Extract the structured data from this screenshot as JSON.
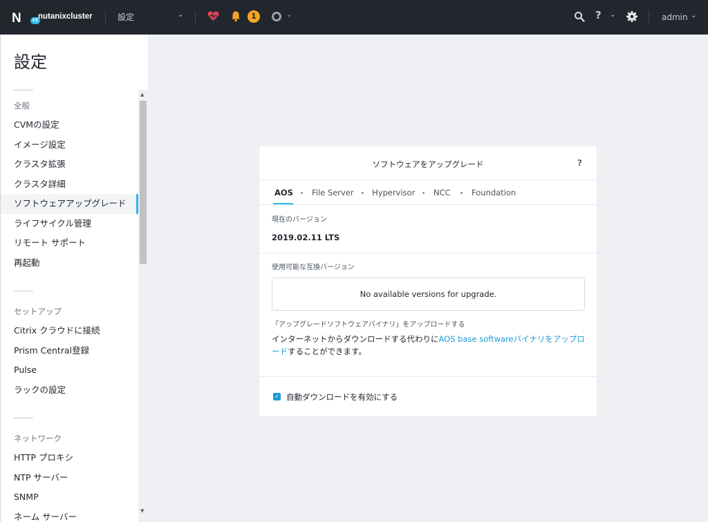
{
  "topbar": {
    "logo_mark": "N",
    "logo_badge": "CE",
    "cluster_name": "nutanixcluster",
    "page_select": "設定",
    "alert_count": "1",
    "help_label": "?",
    "user_name": "admin",
    "colors": {
      "bar": "#22272e",
      "alert_badge": "#f5a623",
      "health": "#e8425a"
    }
  },
  "sidebar": {
    "title": "設定",
    "sections": [
      {
        "header": "全般",
        "items": [
          "CVMの設定",
          "イメージ設定",
          "クラスタ拡張",
          "クラスタ詳細",
          "ソフトウェアアップグレード",
          "ライフサイクル管理",
          "リモート サポート",
          "再起動"
        ]
      },
      {
        "header": "セットアップ",
        "items": [
          "Citrix クラウドに接続",
          "Prism Central登録",
          "Pulse",
          "ラックの設定"
        ]
      },
      {
        "header": "ネットワーク",
        "items": [
          "HTTP プロキシ",
          "NTP サーバー",
          "SNMP",
          "ネーム サーバー"
        ]
      }
    ],
    "active_item": "ソフトウェアアップグレード"
  },
  "panel": {
    "title": "ソフトウェアをアップグレード",
    "help": "?",
    "tabs": [
      "AOS",
      "File Server",
      "Hypervisor",
      "NCC",
      "Foundation"
    ],
    "active_tab": "AOS",
    "current_version_label": "現在のバージョン",
    "current_version": "2019.02.11 LTS",
    "available_label": "使用可能な互換バージョン",
    "available_message": "No available versions for upgrade.",
    "upload_label": "「アップグレードソフトウェアバイナリ」をアップロードする",
    "upload_desc_pre": "インターネットからダウンロードする代わりに",
    "upload_link": "AOS base softwareバイナリをアップロード",
    "upload_desc_post": "することができます。",
    "auto_download_label": "自動ダウンロードを有効にする",
    "auto_download_checked": true,
    "accent": "#26bbf0"
  }
}
